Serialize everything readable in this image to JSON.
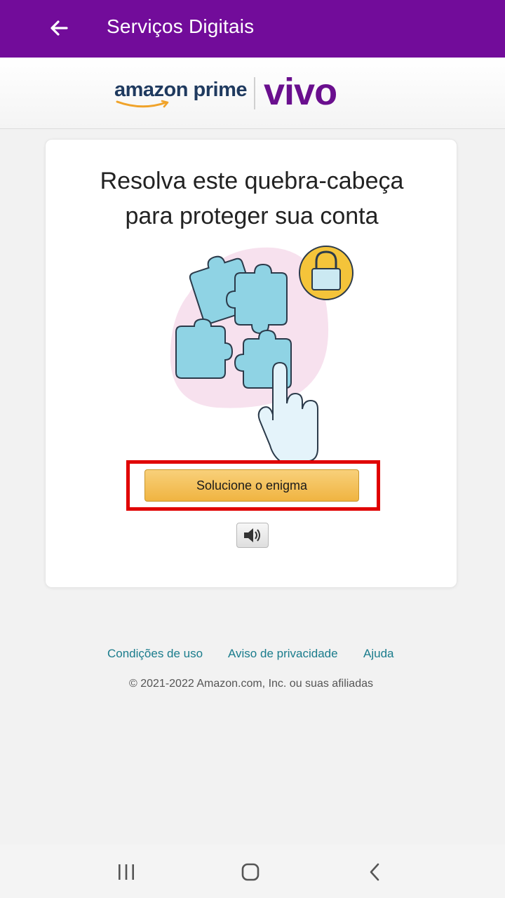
{
  "appbar": {
    "title": "Serviços Digitais",
    "back_icon": "arrow-left-icon",
    "background": "#720c9a"
  },
  "brand": {
    "amazon_logo_text": "amazon prime",
    "vivo_logo_text": "vivo",
    "vivo_color": "#6a0f8e"
  },
  "puzzle": {
    "title_line1": "Resolva este quebra-cabeça",
    "title_line2": "para proteger sua conta",
    "solve_button_label": "Solucione o enigma",
    "audio_icon": "speaker-icon",
    "button_color": "#f0b441",
    "highlight_color": "#e00000"
  },
  "footer": {
    "links": [
      "Condições de uso",
      "Aviso de privacidade",
      "Ajuda"
    ],
    "copyright": "© 2021-2022 Amazon.com, Inc. ou suas afiliadas",
    "link_color": "#1a7c8c"
  },
  "system_nav": {
    "icons": [
      "recent-apps-icon",
      "home-icon",
      "back-icon"
    ]
  }
}
